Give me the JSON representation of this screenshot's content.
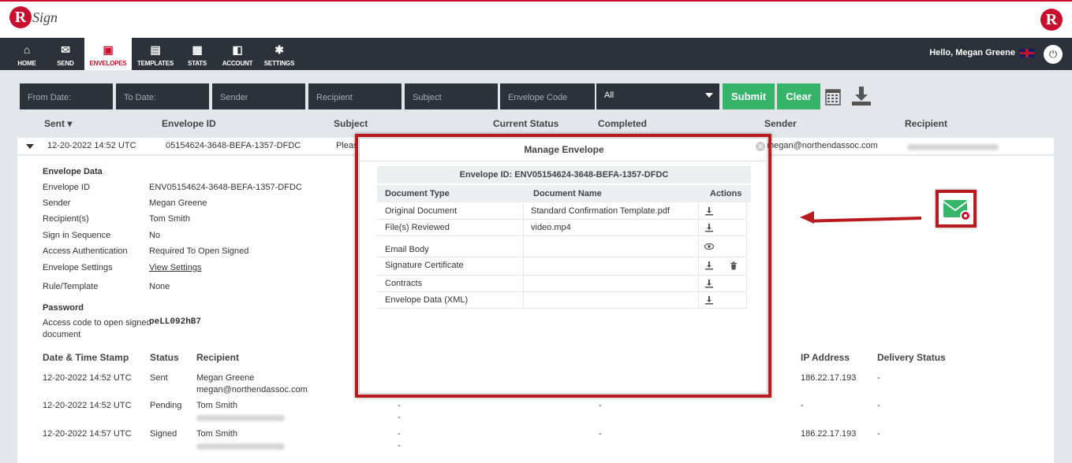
{
  "brand": {
    "logo_letter": "R",
    "logo_text": "Sign"
  },
  "nav": {
    "items": [
      {
        "label": "HOME",
        "icon": "home-icon",
        "glyph": "⌂"
      },
      {
        "label": "SEND",
        "icon": "envelope-icon",
        "glyph": "✉"
      },
      {
        "label": "ENVELOPES",
        "icon": "envelopes-icon",
        "glyph": "▣"
      },
      {
        "label": "TEMPLATES",
        "icon": "templates-icon",
        "glyph": "▤"
      },
      {
        "label": "STATS",
        "icon": "briefcase-icon",
        "glyph": "▦"
      },
      {
        "label": "ACCOUNT",
        "icon": "account-icon",
        "glyph": "◧"
      },
      {
        "label": "SETTINGS",
        "icon": "gear-icon",
        "glyph": "✱"
      }
    ],
    "greeting": "Hello, Megan Greene",
    "power_glyph": "⏻"
  },
  "filters": {
    "from_date": "From Date:",
    "to_date": "To Date:",
    "sender": "Sender",
    "recipient": "Recipient",
    "subject": "Subject",
    "envelope_code": "Envelope Code",
    "status_selected": "All",
    "submit": "Submit",
    "clear": "Clear"
  },
  "table": {
    "headers": {
      "sent": "Sent",
      "sort_glyph": "▾",
      "envelope_id": "Envelope ID",
      "subject": "Subject",
      "current_status": "Current Status",
      "completed": "Completed",
      "sender": "Sender",
      "recipient": "Recipient"
    },
    "row": {
      "sent": "12-20-2022 14:52 UTC",
      "envelope_id": "05154624-3648-BEFA-1357-DFDC",
      "subject": "Pleas",
      "sender": "megan@northendassoc.com"
    }
  },
  "envelope_data": {
    "heading": "Envelope Data",
    "fields": [
      {
        "label": "Envelope ID",
        "value": "ENV05154624-3648-BEFA-1357-DFDC"
      },
      {
        "label": "Sender",
        "value": "Megan Greene"
      },
      {
        "label": "Recipient(s)",
        "value": "Tom Smith"
      },
      {
        "label": "Sign in Sequence",
        "value": "No"
      },
      {
        "label": "Access Authentication",
        "value": "Required To Open Signed"
      },
      {
        "label": "Envelope Settings",
        "value": "View Settings"
      },
      {
        "label": "Rule/Template",
        "value": "None"
      }
    ],
    "password_heading": "Password",
    "access_code_label_1": "Access code to open signed",
    "access_code_label_2": "document",
    "access_code_value": "oeLL092hB7"
  },
  "history": {
    "headers": {
      "timestamp": "Date & Time Stamp",
      "status": "Status",
      "recipient": "Recipient",
      "ip": "IP Address",
      "delivery": "Delivery Status"
    },
    "rows": [
      {
        "timestamp": "12-20-2022 14:52 UTC",
        "status": "Sent",
        "name": "Megan Greene",
        "email": "megan@northendassoc.com",
        "c1": "",
        "c1b": "",
        "c2": "",
        "ip": "186.22.17.193",
        "delivery": "-"
      },
      {
        "timestamp": "12-20-2022 14:52 UTC",
        "status": "Pending",
        "name": "Tom Smith",
        "email": "",
        "c1": "-",
        "c1b": "-",
        "c2": "-",
        "ip": "-",
        "delivery": "-"
      },
      {
        "timestamp": "12-20-2022 14:57 UTC",
        "status": "Signed",
        "name": "Tom Smith",
        "email": "",
        "c1": "-",
        "c1b": "-",
        "c2": "-",
        "ip": "186.22.17.193",
        "delivery": "-"
      }
    ]
  },
  "modal": {
    "title": "Manage Envelope",
    "envelope_id": "Envelope ID: ENV05154624-3648-BEFA-1357-DFDC",
    "headers": {
      "type": "Document Type",
      "name": "Document Name",
      "actions": "Actions"
    },
    "rows": [
      {
        "type": "Original Document",
        "name": "Standard Confirmation Template.pdf",
        "actions": [
          "download-icon"
        ]
      },
      {
        "type": "File(s) Reviewed",
        "name": "video.mp4",
        "actions": [
          "download-icon"
        ]
      },
      {
        "type": "Email Body",
        "name": "",
        "actions": [
          "eye-icon"
        ]
      },
      {
        "type": "Signature Certificate",
        "name": "",
        "actions": [
          "download-icon",
          "trash-icon"
        ]
      },
      {
        "type": "Contracts",
        "name": "",
        "actions": [
          "download-icon"
        ]
      },
      {
        "type": "Envelope Data (XML)",
        "name": "",
        "actions": [
          "download-icon"
        ]
      }
    ]
  },
  "colors": {
    "brand_red": "#c8102e",
    "nav_dark": "#2c313a",
    "green": "#36b56a",
    "annotation_red": "#b81a1d"
  }
}
